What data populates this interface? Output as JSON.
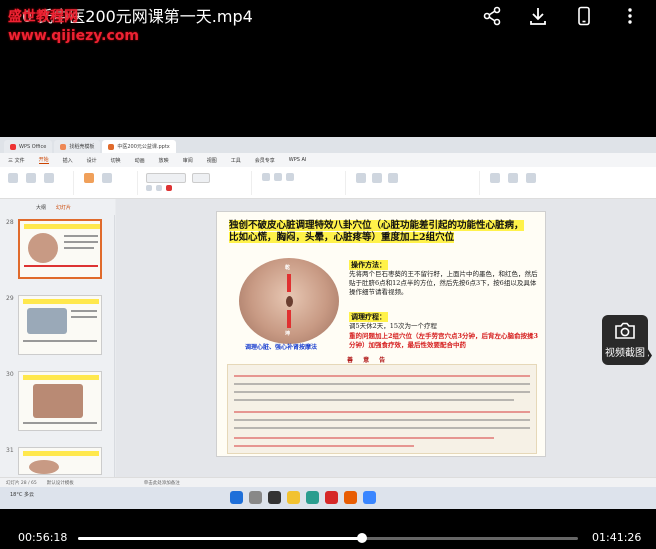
{
  "video": {
    "title": "0   氏中医200元网课第一天.mp4",
    "watermark": "盛世教程网",
    "watermark_url": "www.qijiezy.com",
    "current_time": "00:56:18",
    "total_time": "01:41:26",
    "progress_fraction": 0.568,
    "top_icons": [
      "share-icon",
      "download-icon",
      "phone-icon",
      "more-icon"
    ],
    "screenshot_label": "视频截图"
  },
  "wps": {
    "tabs": [
      {
        "label": "WPS Office",
        "active": false
      },
      {
        "label": "找稻壳模板",
        "active": false
      },
      {
        "label": "中医200元公益课.pptx",
        "active": true
      }
    ],
    "menu": [
      "三 文件",
      "开始",
      "插入",
      "设计",
      "切换",
      "动画",
      "放映",
      "审阅",
      "视图",
      "工具",
      "会员专享",
      "WPS AI"
    ],
    "active_menu": "开始",
    "sidebar_tabs": [
      "大纲",
      "幻灯片"
    ],
    "slide_numbers": [
      "28",
      "29",
      "30",
      "31"
    ],
    "status": [
      "幻灯片 28 / 65",
      "默认设计模板"
    ],
    "notes_hint": "单击此处添加备注",
    "weather": "18°C  多云"
  },
  "slide": {
    "title_a": "独创不破皮心脏调理特效八卦穴位（心脏功能差引起的功能性心脏病，",
    "title_b": "比如心慌，胸闷，头晕，心脏疼等）重度加上2组穴位",
    "belly_top": "乾",
    "belly_bottom": "坤",
    "caption": "调理心脏、强心补肾按摩法",
    "operation_head": "操作方法：",
    "operation_text": "先将两个巨石枣葵的王不留行籽，上面片中的墨色，和红色，然后贴于肚脐6点和12点半的方位，然后先按6点3下，按6组以及具体操作细节请看视频。",
    "course_head": "调理疗程：",
    "course_text": "调5天休2天，15次为一个疗程",
    "red_note": "重的问题加上2组穴位（左手劳宫穴点3分钟，后背左心脑俞按揉3分钟）加强食疗效，最后性效要配合中药",
    "notes_title": "善 意 告"
  }
}
